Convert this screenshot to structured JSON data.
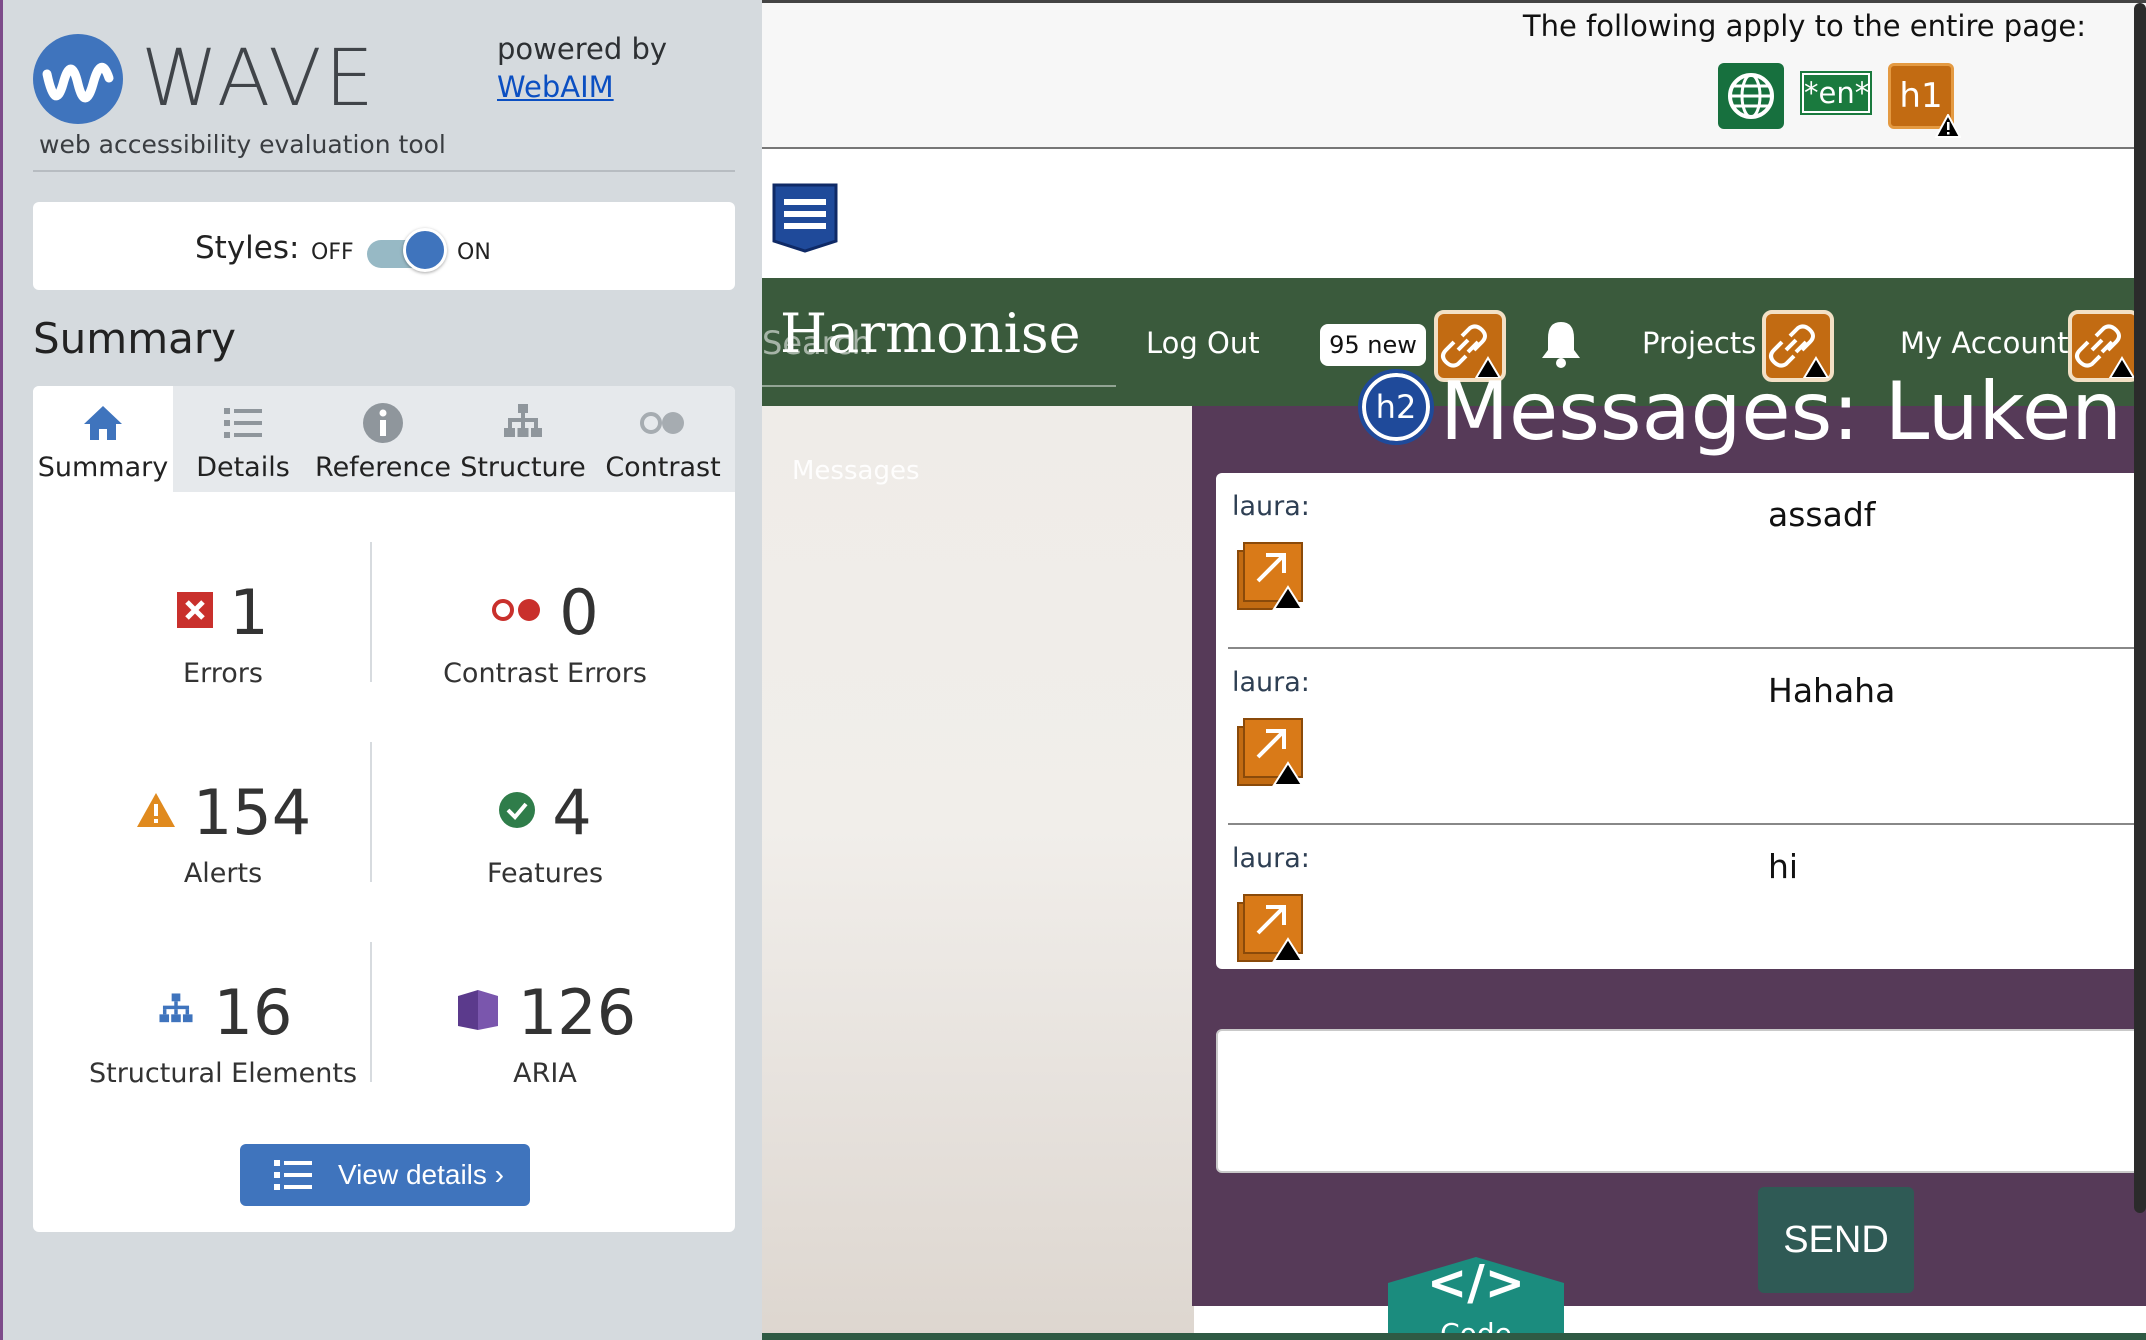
{
  "wave": {
    "logo_text": "WAVE",
    "logo_subtitle": "web accessibility evaluation tool",
    "powered_by": "powered by",
    "webaim_link": "WebAIM",
    "styles_label": "Styles:",
    "styles_off": "OFF",
    "styles_on": "ON",
    "summary_heading": "Summary",
    "tabs": [
      {
        "label": "Summary",
        "icon": "home-icon"
      },
      {
        "label": "Details",
        "icon": "list-icon"
      },
      {
        "label": "Reference",
        "icon": "info-icon"
      },
      {
        "label": "Structure",
        "icon": "hierarchy-icon"
      },
      {
        "label": "Contrast",
        "icon": "contrast-icon"
      }
    ],
    "stats": {
      "errors": {
        "value": "1",
        "label": "Errors",
        "color": "#c9302c"
      },
      "contrast_errors": {
        "value": "0",
        "label": "Contrast Errors",
        "color": "#c9302c"
      },
      "alerts": {
        "value": "154",
        "label": "Alerts",
        "color": "#e08a1e"
      },
      "features": {
        "value": "4",
        "label": "Features",
        "color": "#2f7d4a"
      },
      "structural": {
        "value": "16",
        "label": "Structural Elements",
        "color": "#3f74bd"
      },
      "aria": {
        "value": "126",
        "label": "ARIA",
        "color": "#5b3a8c"
      }
    },
    "view_details": "View details ›"
  },
  "page": {
    "apply_text": "The following apply to the entire page:",
    "lang_badge": "*en*",
    "h1_badge": "h1",
    "brand": "Harmonise",
    "search_ghost": "Search",
    "nav": {
      "logout": "Log Out",
      "new_count": "95 new",
      "projects": "Projects",
      "account": "My Account"
    },
    "messages_ghost": "Messages",
    "h2_badge": "h2",
    "messages_title": "Messages: Luken",
    "messages": [
      {
        "author": "laura:",
        "text": "assadf"
      },
      {
        "author": "laura:",
        "text": "Hahaha"
      },
      {
        "author": "laura:",
        "text": "hi"
      }
    ],
    "send_label": "SEND",
    "code_label": "Code",
    "code_symbol": "</>"
  },
  "colors": {
    "wave_blue": "#3f74bd",
    "nav_green": "#3a5a3c",
    "chat_purple": "#563a58",
    "alert_orange": "#c26b12"
  }
}
